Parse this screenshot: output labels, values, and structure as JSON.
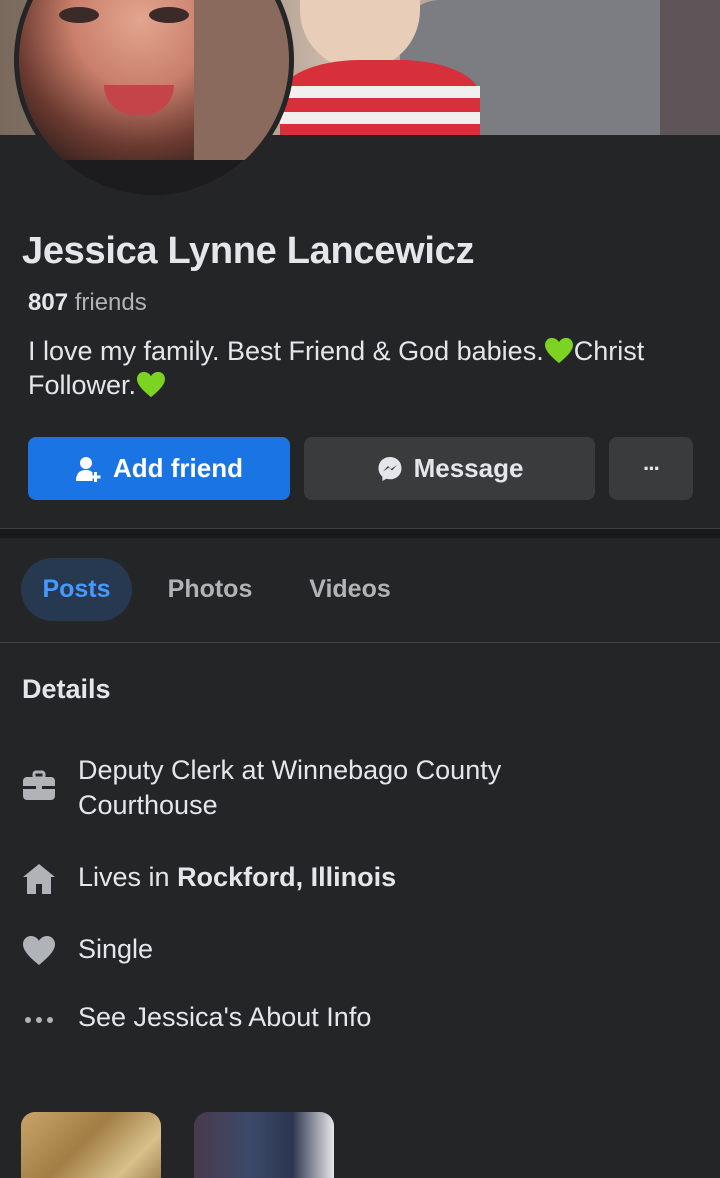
{
  "profile": {
    "name": "Jessica Lynne Lancewicz",
    "friends_count": "807",
    "friends_label": "friends",
    "bio_part1": "I love my family. Best Friend & God babies.",
    "bio_part2": "Christ Follower."
  },
  "actions": {
    "add_friend": "Add friend",
    "message": "Message",
    "more": "···"
  },
  "tabs": [
    {
      "label": "Posts",
      "active": true
    },
    {
      "label": "Photos",
      "active": false
    },
    {
      "label": "Videos",
      "active": false
    }
  ],
  "details": {
    "title": "Details",
    "work_line1": "Deputy Clerk at Winnebago County",
    "work_line2": "Courthouse",
    "lives_prefix": "Lives in ",
    "lives_place": "Rockford, Illinois",
    "relationship": "Single",
    "about_link": "See Jessica's About Info"
  },
  "icons": {
    "work": "briefcase-icon",
    "home": "home-icon",
    "relationship": "heart-icon",
    "more": "ellipsis-icon",
    "add_friend": "add-person-icon",
    "message": "messenger-icon",
    "bio_emoji": "green-heart-emoji"
  },
  "colors": {
    "background": "#242526",
    "primary_button": "#1b74e4",
    "secondary_button": "#3a3b3c",
    "active_tab_bg": "#263951",
    "active_tab_text": "#4599ff",
    "green_heart": "#7dd321"
  }
}
